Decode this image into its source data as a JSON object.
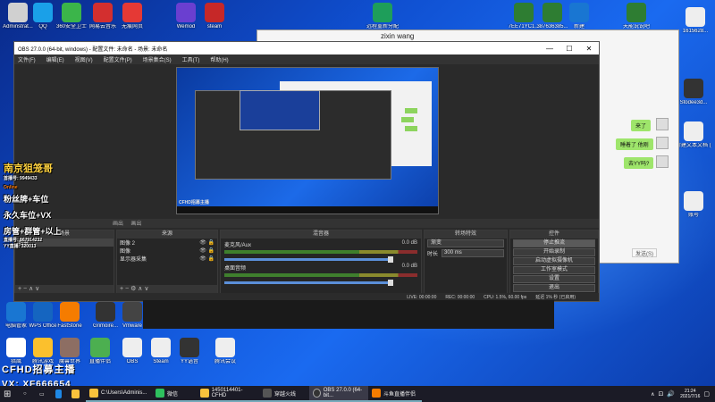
{
  "desktop": {
    "icons_top": [
      {
        "label": "Adminstrat...",
        "color": "#d0d0d0",
        "glyph": ""
      },
      {
        "label": "QQ",
        "color": "#1aa0e8",
        "glyph": ""
      },
      {
        "label": "360安全卫士",
        "color": "#3bb54a",
        "glyph": ""
      },
      {
        "label": "网易云音乐",
        "color": "#d32f2f",
        "glyph": ""
      },
      {
        "label": "无痕网页",
        "color": "#e53935",
        "glyph": ""
      },
      {
        "label": "Wemod",
        "color": "#6a3fd0",
        "glyph": ""
      },
      {
        "label": "steam",
        "color": "#c62828",
        "glyph": ""
      }
    ],
    "icons_top_right": [
      {
        "label": "远程重新分配",
        "color": "#1e9e5a"
      },
      {
        "label": "7EE71YC1...",
        "color": "#2e7d32"
      },
      {
        "label": "387636385...",
        "color": "#2e7d32"
      },
      {
        "label": "新建",
        "color": "#1976d2"
      },
      {
        "label": "天能说说吧",
        "color": "#2e7d32"
      },
      {
        "label": "1615628...",
        "color": "#eeeeee"
      }
    ],
    "icons_right": [
      {
        "label": "Stodee3d...",
        "color": "#333"
      },
      {
        "label": "新建文本文档 (2)",
        "color": "#eee"
      },
      {
        "label": "账号",
        "color": "#eee"
      }
    ],
    "icons_bottom_row1": [
      {
        "label": "电脑管家",
        "color": "#1976d2"
      },
      {
        "label": "WPS Office",
        "color": "#1565c0"
      },
      {
        "label": "FastStone",
        "color": "#f57c00"
      },
      {
        "label": "Grimoire...",
        "color": "#333"
      },
      {
        "label": "Vmware",
        "color": "#444"
      }
    ],
    "icons_bottom_row2": [
      {
        "label": "猎鹰",
        "color": "#fff"
      },
      {
        "label": "腾讯游戏",
        "color": "#fbc02d"
      },
      {
        "label": "魔兽世界",
        "color": "#8d6e63"
      },
      {
        "label": "直播伴侣",
        "color": "#4caf50"
      },
      {
        "label": "OBS",
        "color": "#eee"
      },
      {
        "label": "Steam",
        "color": "#eee"
      },
      {
        "label": "YY语音",
        "color": "#333"
      },
      {
        "label": "腾讯会议",
        "color": "#eee"
      }
    ]
  },
  "overlay": {
    "line1": "南京狙笼哥",
    "line2": "粉丝牌+车位",
    "line3": "永久车位+VX",
    "line4": "房管+群管+以上",
    "small1": "首播号: 9949433",
    "small2": "直播号: 867914232",
    "small3": "YY直播: 320013",
    "logo": "Online"
  },
  "chat": {
    "title": "zixin wang",
    "bubbles": [
      "来了",
      "睡着了 他刚",
      "去YY吗?"
    ],
    "send": "发送(S)"
  },
  "obs": {
    "title": "OBS 27.0.0 (64-bit, windows) - 配置文件: 未命名 - 场景: 未命名",
    "menu": [
      "文件(F)",
      "编辑(E)",
      "视图(V)",
      "配置文件(P)",
      "场景集合(S)",
      "工具(T)",
      "帮助(H)"
    ],
    "preview_label": "CFHD招募主播",
    "scene_bar": [
      "画出",
      "画出"
    ],
    "docks": {
      "scenes_title": "场景",
      "scenes": [
        "场景"
      ],
      "sources_title": "来源",
      "sources": [
        "图像 2",
        "图像",
        "显示器采集"
      ],
      "mixer_title": "混音器",
      "mixer": [
        {
          "name": "麦克风/Aux",
          "db": "0.0 dB"
        },
        {
          "name": "桌面音频",
          "db": "0.0 dB"
        }
      ],
      "transitions_title": "转场特效",
      "transition": "渐变",
      "duration_label": "时长",
      "duration": "300 ms",
      "controls_title": "控件",
      "controls": [
        "停止推流",
        "开始录制",
        "启动虚拟摄像机",
        "工作室模式",
        "设置",
        "退出"
      ]
    },
    "status": {
      "live": "LIVE: 00:00:00",
      "rec": "REC: 00:00:00",
      "cpu": "CPU: 1.5%, 60.00 fps",
      "info": "延迟 1% 秒 (已启用)"
    }
  },
  "recruit": {
    "line1": "CFHD招募主播",
    "line2": "VX: XF666654"
  },
  "taskbar": {
    "items": [
      {
        "label": "C:\\Users\\Adminis...",
        "color": "#f9c23c"
      },
      {
        "label": "微信",
        "color": "#2ec05e"
      },
      {
        "label": "1450114401-CFHD",
        "color": "#f9c23c"
      },
      {
        "label": "穿越火线",
        "color": "#555"
      },
      {
        "label": "OBS 27.0.0 (64-bit...",
        "color": "#333"
      },
      {
        "label": "斗鱼直播伴侣",
        "color": "#f57c00"
      }
    ],
    "time": "21:24",
    "date": "2021/7/16"
  }
}
